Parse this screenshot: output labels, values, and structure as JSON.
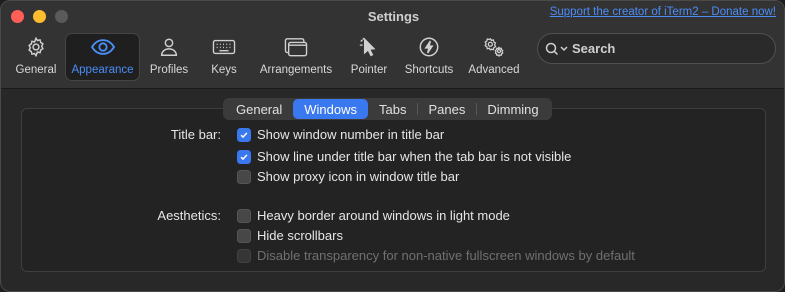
{
  "window": {
    "title": "Settings",
    "donate_link": "Support the creator of iTerm2 – Donate now!"
  },
  "toolbar": {
    "items": [
      {
        "label": "General",
        "icon": "gear-icon",
        "active": false
      },
      {
        "label": "Appearance",
        "icon": "eye-icon",
        "active": true
      },
      {
        "label": "Profiles",
        "icon": "person-icon",
        "active": false
      },
      {
        "label": "Keys",
        "icon": "keyboard-icon",
        "active": false
      },
      {
        "label": "Arrangements",
        "icon": "windows-icon",
        "active": false
      },
      {
        "label": "Pointer",
        "icon": "pointer-icon",
        "active": false
      },
      {
        "label": "Shortcuts",
        "icon": "lightning-icon",
        "active": false
      },
      {
        "label": "Advanced",
        "icon": "gears-icon",
        "active": false
      }
    ],
    "search_placeholder": "Search"
  },
  "tabs": {
    "items": [
      "General",
      "Windows",
      "Tabs",
      "Panes",
      "Dimming"
    ],
    "selected": "Windows"
  },
  "sections": {
    "title_bar": {
      "label": "Title bar:",
      "options": [
        {
          "text": "Show window number in title bar",
          "checked": true,
          "enabled": true
        },
        {
          "text": "Show line under title bar when the tab bar is not visible",
          "checked": true,
          "enabled": true
        },
        {
          "text": "Show proxy icon in window title bar",
          "checked": false,
          "enabled": true
        }
      ]
    },
    "aesthetics": {
      "label": "Aesthetics:",
      "options": [
        {
          "text": "Heavy border around windows in light mode",
          "checked": false,
          "enabled": true
        },
        {
          "text": "Hide scrollbars",
          "checked": false,
          "enabled": true
        },
        {
          "text": "Disable transparency for non-native fullscreen windows by default",
          "checked": false,
          "enabled": false
        }
      ]
    }
  },
  "colors": {
    "accent": "#3a78f0",
    "link": "#4b8df8",
    "close": "#ff5f57",
    "minimize": "#febc2e"
  }
}
